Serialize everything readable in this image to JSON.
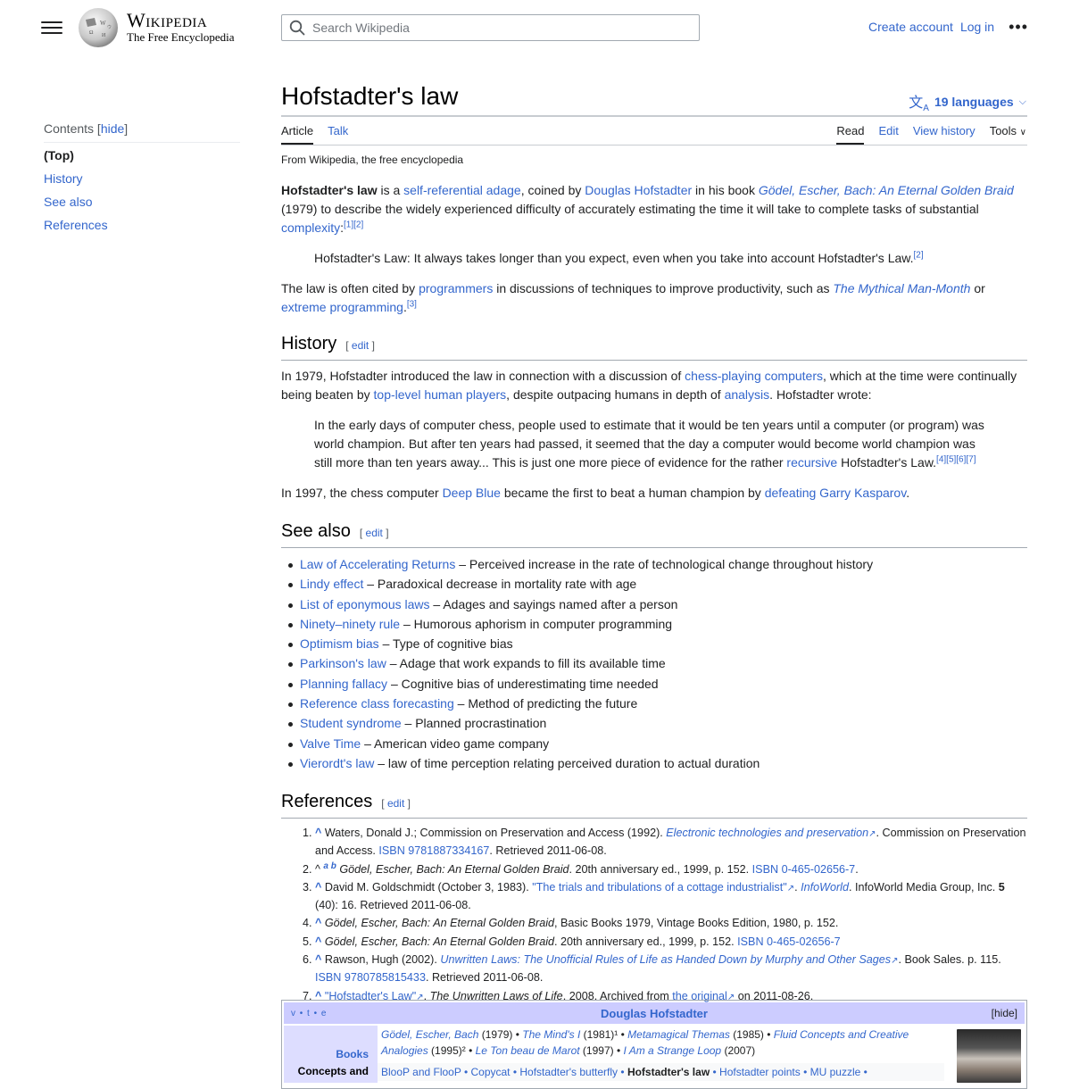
{
  "header": {
    "wordmark": "Wikipedia",
    "tagline": "The Free Encyclopedia",
    "search_placeholder": "Search Wikipedia",
    "create_account": "Create account",
    "log_in": "Log in",
    "more_icon": "ellipsis-icon"
  },
  "toc": {
    "heading": "Contents",
    "hide": "hide",
    "items": [
      "(Top)",
      "History",
      "See also",
      "References"
    ]
  },
  "page": {
    "title": "Hofstadter's law",
    "languages": "19 languages",
    "tabs_left": [
      "Article",
      "Talk"
    ],
    "tabs_right": [
      "Read",
      "Edit",
      "View history",
      "Tools"
    ],
    "tagline": "From Wikipedia, the free encyclopedia"
  },
  "intro": {
    "bold": "Hofstadter's law",
    "t1": " is a ",
    "l1": "self-referential adage",
    "t2": ", coined by ",
    "l2": "Douglas Hofstadter",
    "t3": " in his book ",
    "l3": "Gödel, Escher, Bach: An Eternal Golden Braid",
    "t4": " (1979) to describe the widely experienced difficulty of accurately estimating the time it will take to complete tasks of substantial ",
    "l4": "complexity",
    "t5": ":",
    "cite": "[1][2]",
    "quote": "Hofstadter's Law: It always takes longer than you expect, even when you take into account Hofstadter's Law.",
    "quote_cite": "[2]",
    "p2_t1": "The law is often cited by ",
    "p2_l1": "programmers",
    "p2_t2": " in discussions of techniques to improve productivity, such as ",
    "p2_l2": "The Mythical Man-Month",
    "p2_t3": " or ",
    "p2_l3": "extreme programming",
    "p2_t4": ".",
    "p2_cite": "[3]"
  },
  "history": {
    "heading": "History",
    "edit": "edit",
    "t1": "In 1979, Hofstadter introduced the law in connection with a discussion of ",
    "l1": "chess-playing computers",
    "t2": ", which at the time were continually being beaten by ",
    "l2": "top-level human players",
    "t3": ", despite outpacing humans in depth of ",
    "l3": "analysis",
    "t4": ". Hofstadter wrote:",
    "q1": "In the early days of computer chess, people used to estimate that it would be ten years until a computer (or program) was world champion. But after ten years had passed, it seemed that the day a computer would become world champion was still more than ten years away... This is just one more piece of evidence for the rather ",
    "ql": "recursive",
    "q2": " Hofstadter's Law.",
    "qcite": "[4][5][6][7]",
    "p3_t1": "In 1997, the chess computer ",
    "p3_l1": "Deep Blue",
    "p3_t2": " became the first to beat a human champion by ",
    "p3_l2": "defeating Garry Kasparov",
    "p3_t3": "."
  },
  "see_also": {
    "heading": "See also",
    "edit": "edit",
    "items": [
      {
        "link": "Law of Accelerating Returns",
        "desc": " – Perceived increase in the rate of technological change throughout history"
      },
      {
        "link": "Lindy effect",
        "desc": " – Paradoxical decrease in mortality rate with age"
      },
      {
        "link": "List of eponymous laws",
        "desc": " – Adages and sayings named after a person"
      },
      {
        "link": "Ninety–ninety rule",
        "desc": " – Humorous aphorism in computer programming"
      },
      {
        "link": "Optimism bias",
        "desc": " – Type of cognitive bias"
      },
      {
        "link": "Parkinson's law",
        "desc": " – Adage that work expands to fill its available time"
      },
      {
        "link": "Planning fallacy",
        "desc": " – Cognitive bias of underestimating time needed"
      },
      {
        "link": "Reference class forecasting",
        "desc": " – Method of predicting the future"
      },
      {
        "link": "Student syndrome",
        "desc": " – Planned procrastination"
      },
      {
        "link": "Valve Time",
        "desc": " – American video game company"
      },
      {
        "link": "Vierordt's law",
        "desc": " – law of time perception relating perceived duration to actual duration"
      }
    ]
  },
  "references": {
    "heading": "References",
    "edit": "edit",
    "r1": {
      "a": "Waters, Donald J.; Commission on Preservation and Access (1992). ",
      "link": "Electronic technologies and preservation",
      "b": ". Commission on Preservation and Access. ",
      "isbn": "ISBN 9781887334167",
      "c": ". Retrieved 2011-06-08."
    },
    "r2": {
      "backlinks": "a b",
      "title": "Gödel, Escher, Bach: An Eternal Golden Braid",
      "b": ". 20th anniversary ed., 1999, p. 152. ",
      "isbn": "ISBN 0-465-02656-7",
      "c": "."
    },
    "r3": {
      "a": "David M. Goldschmidt (October 3, 1983). ",
      "link": "\"The trials and tribulations of a cottage industrialist\"",
      "b": ". ",
      "pub": "InfoWorld",
      "c": ". InfoWorld Media Group, Inc. ",
      "vol": "5",
      "d": " (40): 16. Retrieved 2011-06-08."
    },
    "r4": {
      "title": "Gödel, Escher, Bach: An Eternal Golden Braid",
      "b": ", Basic Books 1979, Vintage Books Edition, 1980, p. 152."
    },
    "r5": {
      "title": "Gödel, Escher, Bach: An Eternal Golden Braid",
      "b": ". 20th anniversary ed., 1999, p. 152. ",
      "isbn": "ISBN 0-465-02656-7"
    },
    "r6": {
      "a": "Rawson, Hugh (2002). ",
      "link": "Unwritten Laws: The Unofficial Rules of Life as Handed Down by Murphy and Other Sages",
      "b": ". Book Sales. p. 115. ",
      "isbn": "ISBN 9780785815433",
      "c": ". Retrieved 2011-06-08."
    },
    "r7": {
      "link": "\"Hofstadter's Law\"",
      "b": ". ",
      "title": "The Unwritten Laws of Life",
      "c": ". 2008. Archived from ",
      "link2": "the original",
      "d": " on 2011-08-26."
    }
  },
  "navbox": {
    "vte": "v • t • e",
    "title": "Douglas Hofstadter",
    "hide": "[hide]",
    "group1": "Books",
    "books": [
      {
        "title": "Gödel, Escher, Bach",
        "year": " (1979) • "
      },
      {
        "title": "The Mind's I",
        "year": " (1981)¹ • "
      },
      {
        "title": "Metamagical Themas",
        "year": " (1985) • "
      },
      {
        "title": "Fluid Concepts and Creative Analogies",
        "year": " (1995)² • "
      },
      {
        "title": "Le Ton beau de Marot",
        "year": " (1997) • "
      },
      {
        "title": "I Am a Strange Loop",
        "year": " (2007)"
      }
    ],
    "group2": "Concepts and",
    "concepts": "BlooP and FlooP • Copycat • Hofstadter's butterfly • ",
    "concepts_bold": "Hofstadter's law",
    "concepts_tail": " • Hofstadter points • MU puzzle •"
  }
}
